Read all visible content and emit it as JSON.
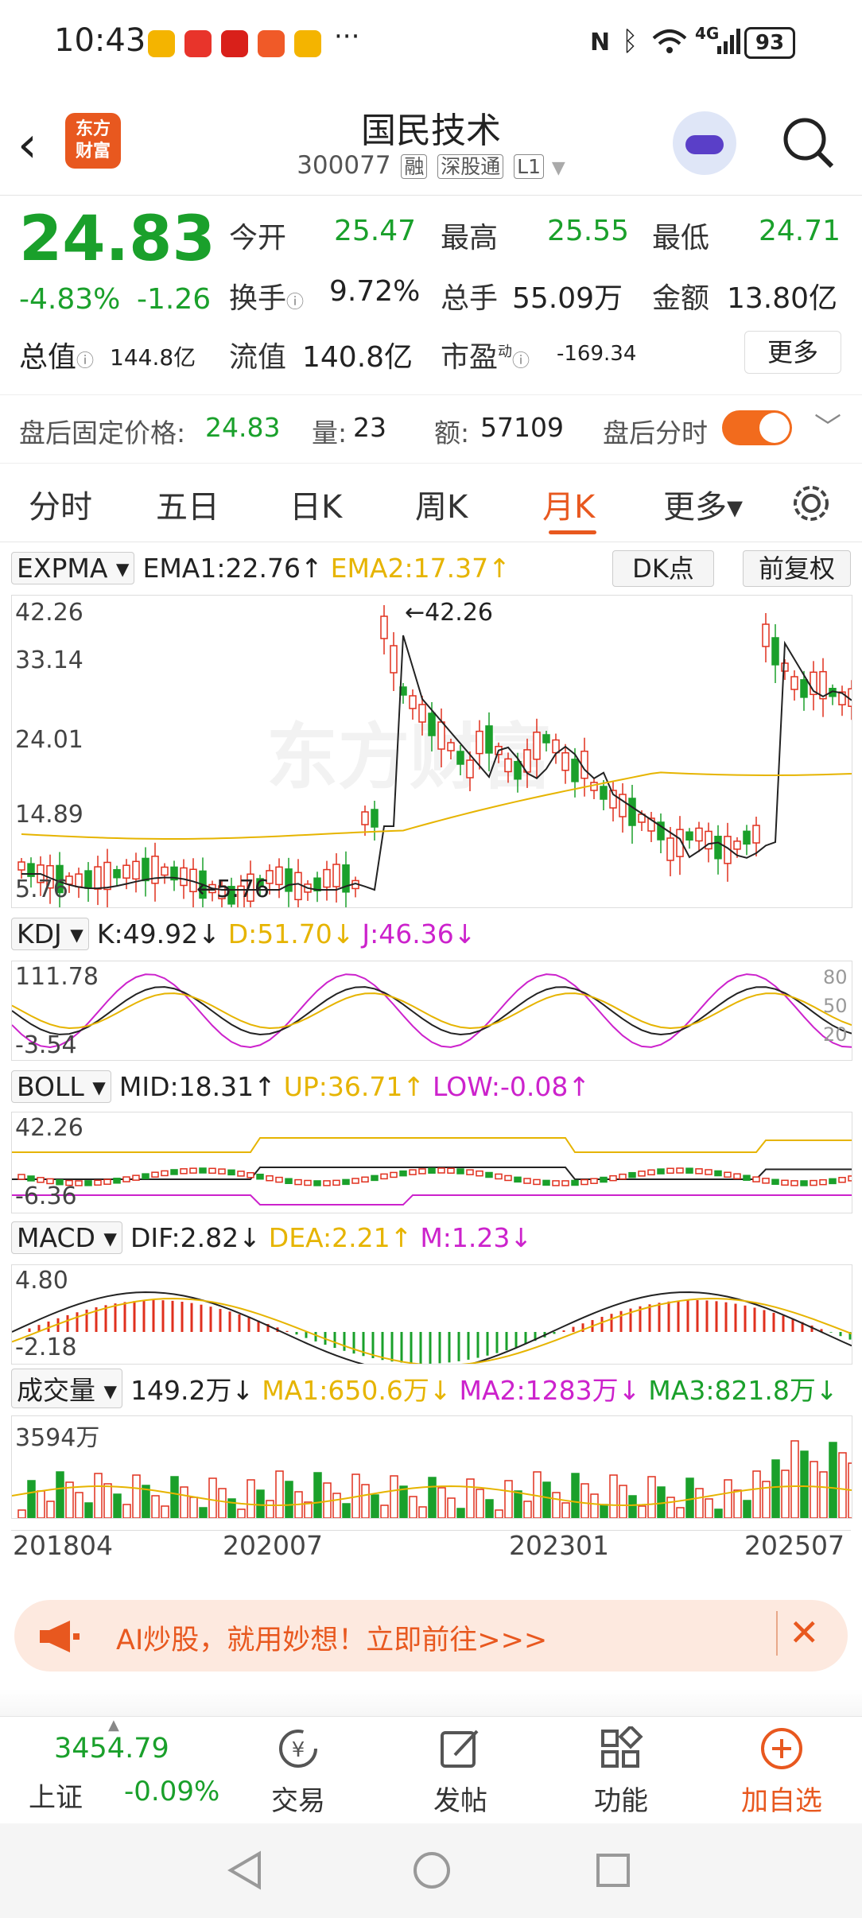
{
  "status": {
    "time": "10:43",
    "dots": "···",
    "network": "4G",
    "battery": "93"
  },
  "header": {
    "logo_line1": "东方",
    "logo_line2": "财富",
    "title": "国民技术",
    "code": "300077",
    "tags": [
      "融",
      "深股通",
      "L1"
    ]
  },
  "quote": {
    "price": "24.83",
    "change_pct": "-4.83%",
    "change": "-1.26",
    "open_label": "今开",
    "open": "25.47",
    "high_label": "最高",
    "high": "25.55",
    "low_label": "最低",
    "low": "24.71",
    "turnover_label": "换手",
    "turnover": "9.72%",
    "volume_label": "总手",
    "volume": "55.09万",
    "amount_label": "金额",
    "amount": "13.80亿",
    "mktcap_label": "总值",
    "mktcap": "144.8亿",
    "float_label": "流值",
    "float_cap": "140.8亿",
    "pe_label": "市盈",
    "pe_sup": "动",
    "pe": "-169.34",
    "more": "更多"
  },
  "afterhours": {
    "price_label": "盘后固定价格:",
    "price": "24.83",
    "vol_label": "量:",
    "vol": "23",
    "amt_label": "额:",
    "amt": "57109",
    "toggle_label": "盘后分时"
  },
  "tabs": [
    "分时",
    "五日",
    "日K",
    "周K",
    "月K",
    "更多▾"
  ],
  "active_tab": 4,
  "chart": {
    "main": {
      "indicator": "EXPMA",
      "ema1": "EMA1:22.76↑",
      "ema2": "EMA2:17.37↑",
      "dk": "DK点",
      "adj": "前复权",
      "ticks": [
        "42.26",
        "33.14",
        "24.01",
        "14.89",
        "5.76"
      ],
      "high_note": "←42.26",
      "low_note": "←5.76",
      "watermark": "东方财富"
    },
    "kdj": {
      "indicator": "KDJ",
      "k": "K:49.92↓",
      "d": "D:51.70↓",
      "j": "J:46.36↓",
      "top": "111.78",
      "bottom": "-3.54",
      "levels": [
        "80",
        "50",
        "20"
      ]
    },
    "boll": {
      "indicator": "BOLL",
      "mid": "MID:18.31↑",
      "up": "UP:36.71↑",
      "low": "LOW:-0.08↑",
      "top": "42.26",
      "bottom": "-6.36"
    },
    "macd": {
      "indicator": "MACD",
      "dif": "DIF:2.82↓",
      "dea": "DEA:2.21↑",
      "m": "M:1.23↓",
      "top": "4.80",
      "bottom": "-2.18"
    },
    "vol": {
      "indicator": "成交量",
      "v": "149.2万↓",
      "ma1": "MA1:650.6万↓",
      "ma2": "MA2:1283万↓",
      "ma3": "MA3:821.8万↓",
      "top": "3594万"
    },
    "dates": [
      "201804",
      "202007",
      "202301",
      "202507"
    ]
  },
  "colors": {
    "up": "#e0301e",
    "down": "#1aa02b",
    "accent": "#e8581f",
    "ema1": "#222222",
    "ema2": "#e6b400",
    "magenta": "#cc22cc"
  },
  "banner": {
    "text": "AI炒股，就用妙想！立即前往>>>"
  },
  "bottom": {
    "index_value": "3454.79",
    "index_name": "上证",
    "index_change": "-0.09%",
    "items": [
      {
        "label": "交易",
        "icon": "trade-icon"
      },
      {
        "label": "发帖",
        "icon": "edit-icon"
      },
      {
        "label": "功能",
        "icon": "grid-icon"
      },
      {
        "label": "加自选",
        "icon": "add-circle-icon"
      }
    ]
  }
}
